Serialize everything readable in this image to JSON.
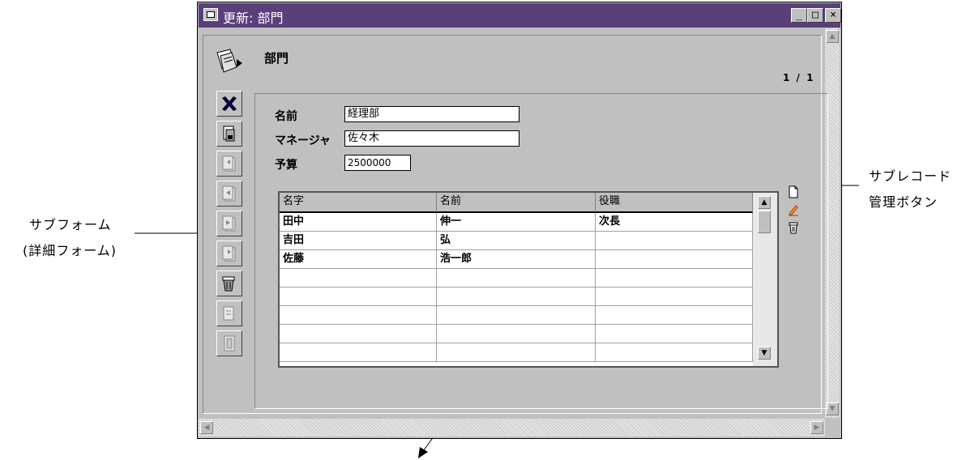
{
  "annotations": {
    "subrecord_buttons_line1": "サブレコード",
    "subrecord_buttons_line2": "管理ボタン",
    "subform_line1": "サブフォーム",
    "subform_line2": "(詳細フォーム)"
  },
  "window": {
    "title": "更新: 部門",
    "minimize": "_",
    "maximize": "□",
    "close": "×"
  },
  "form": {
    "table_name": "部門",
    "record_indicator": "1 / 1",
    "fields": [
      {
        "label": "名前",
        "value": "経理部"
      },
      {
        "label": "マネージャ",
        "value": "佐々木"
      },
      {
        "label": "予算",
        "value": "2500000"
      }
    ]
  },
  "subform": {
    "columns": [
      "名字",
      "名前",
      "役職"
    ],
    "rows": [
      [
        "田中",
        "伸一",
        "次長"
      ],
      [
        "吉田",
        "弘",
        ""
      ],
      [
        "佐藤",
        "浩一郎",
        ""
      ],
      [
        "",
        "",
        ""
      ],
      [
        "",
        "",
        ""
      ],
      [
        "",
        "",
        ""
      ],
      [
        "",
        "",
        ""
      ],
      [
        "",
        "",
        ""
      ]
    ]
  },
  "toolbar": [
    "cancel",
    "accept",
    "first-record",
    "previous-record",
    "next-record",
    "last-record",
    "delete-record",
    "add-record",
    "exit"
  ]
}
